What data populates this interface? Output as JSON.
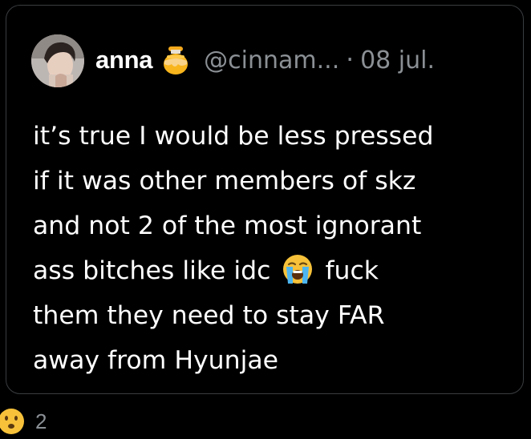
{
  "tweet": {
    "author": {
      "display_name": "anna",
      "handle": "@cinnam...",
      "name_emoji": "honey-pot-icon",
      "avatar": "avatar-photo"
    },
    "separator": "·",
    "date": "08 jul.",
    "text_lines": [
      "it’s true I would be less pressed",
      "if it was other members of skz",
      "and not 2 of the most ignorant",
      "ass bitches like idc",
      "fuck",
      "them they need to stay FAR",
      "away from Hyunjae"
    ],
    "inline_emoji": "loudly-crying-face-icon"
  },
  "footer": {
    "reaction_emoji": "face-icon",
    "count": "2"
  },
  "colors": {
    "background": "#000000",
    "text": "#ffffff",
    "muted": "#8b9095",
    "border": "#3a3d40"
  }
}
